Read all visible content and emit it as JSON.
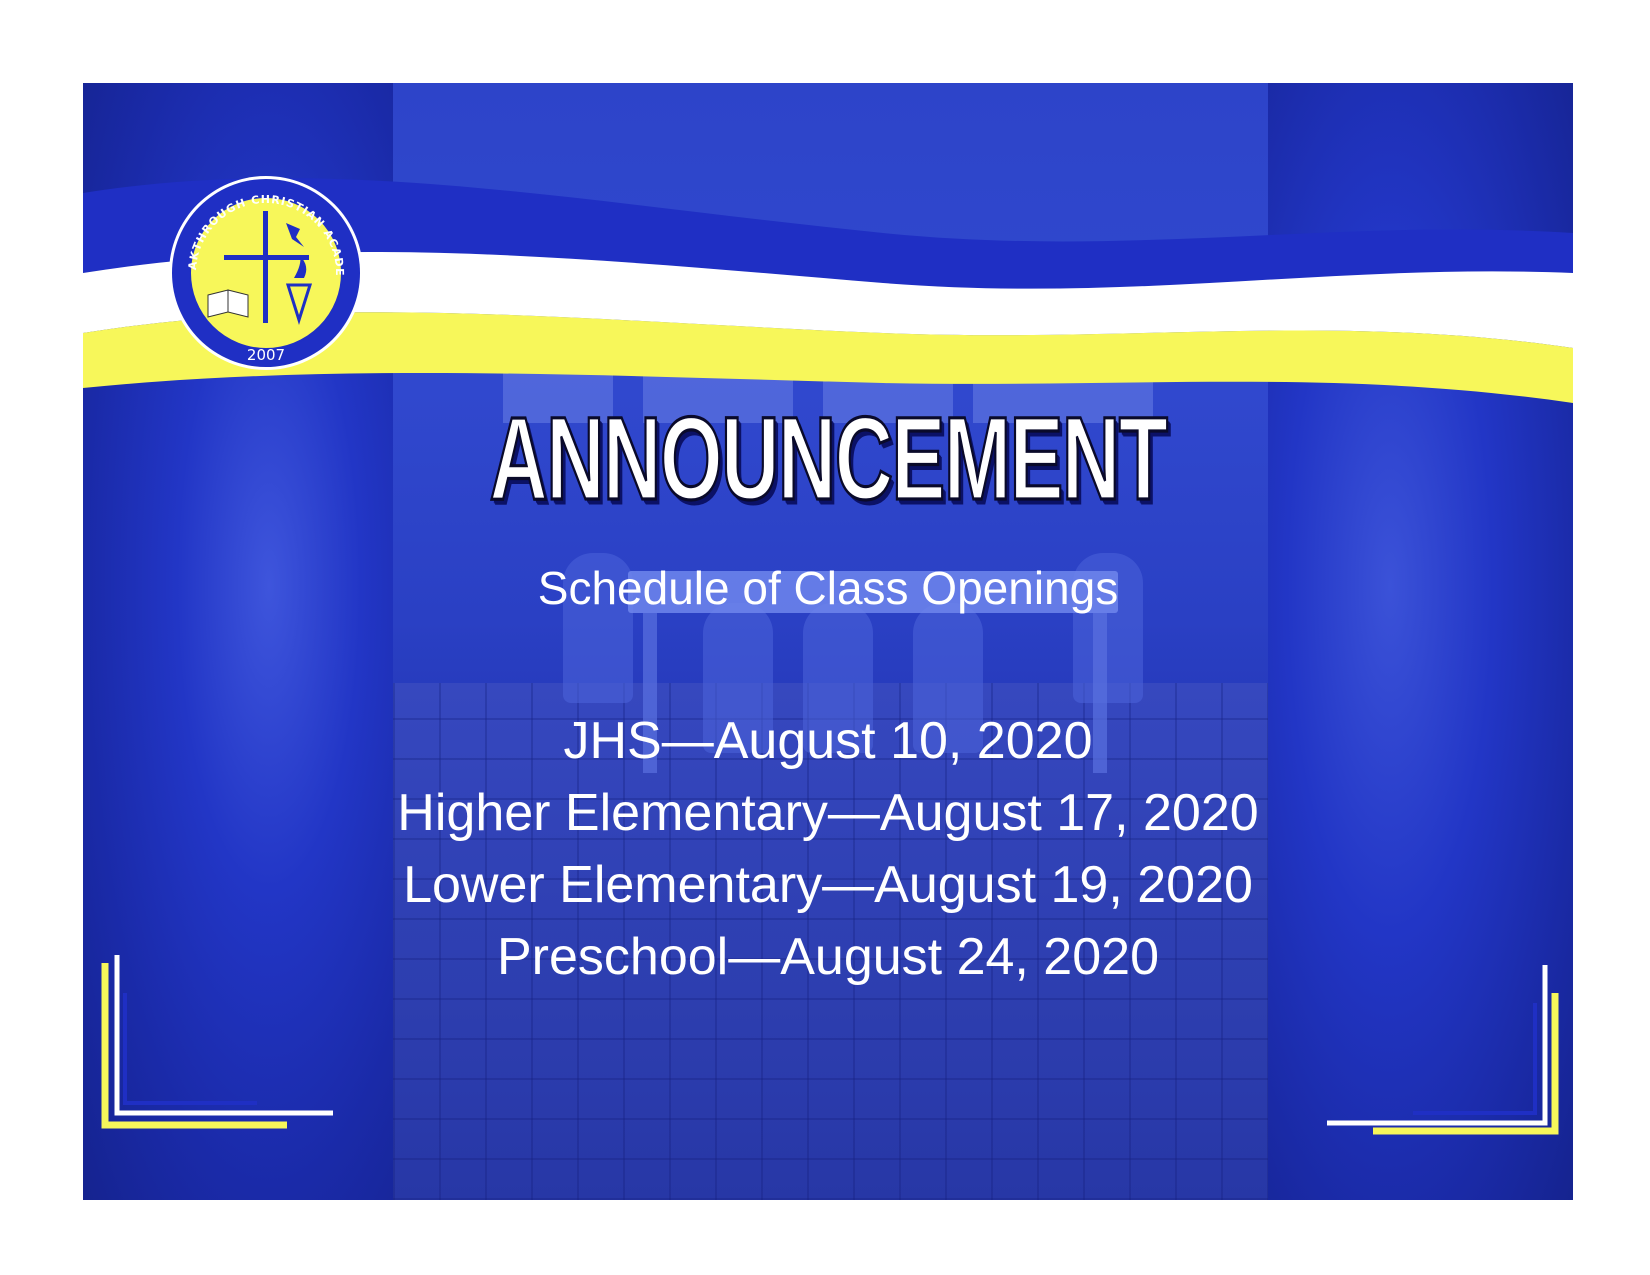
{
  "logo": {
    "ring_text": "BREAKTHROUGH CHRISTIAN ACADEMY",
    "year": "2007"
  },
  "title": "ANNOUNCEMENT",
  "subtitle": "Schedule of Class Openings",
  "schedule": [
    "JHS—August 10, 2020",
    "Higher Elementary—August 17, 2020",
    "Lower Elementary—August 19, 2020",
    "Preschool—August 24, 2020"
  ],
  "colors": {
    "brand_blue": "#1f2fc4",
    "brand_yellow": "#f7f75a",
    "white": "#ffffff"
  }
}
